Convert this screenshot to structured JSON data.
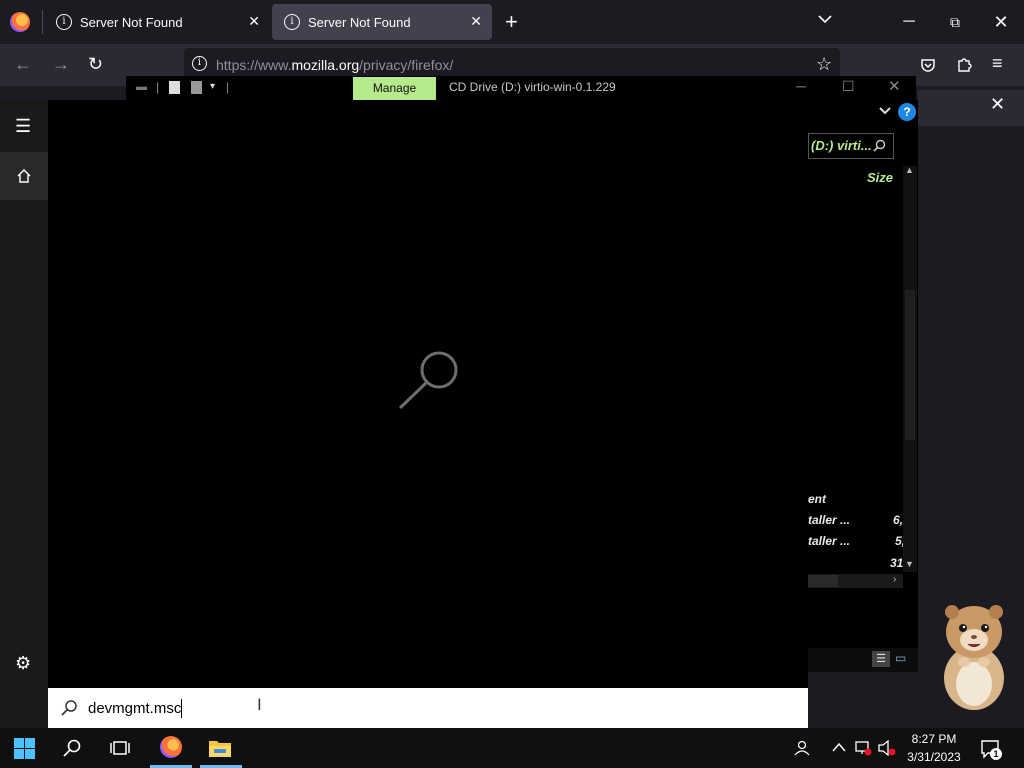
{
  "browser": {
    "tabs": [
      {
        "label": "Server Not Found",
        "active": false
      },
      {
        "label": "Server Not Found",
        "active": true
      }
    ],
    "url": {
      "prefix": "https://www.",
      "domain": "mozilla.org",
      "path": "/privacy/firefox/"
    }
  },
  "explorer": {
    "manage_label": "Manage",
    "title": "CD Drive (D:) virtio-win-0.1.229",
    "search_text": "(D:) virti...",
    "size_header": "Size",
    "rows": [
      {
        "name": "ent",
        "size": ""
      },
      {
        "name": "taller ...",
        "size": "6,"
      },
      {
        "name": "taller ...",
        "size": "5,"
      },
      {
        "name": "",
        "size": "31,"
      }
    ]
  },
  "start_search": {
    "query": "devmgmt.msc"
  },
  "taskbar": {
    "time": "8:27 PM",
    "date": "3/31/2023",
    "notification_count": "1"
  },
  "colors": {
    "accent_green": "#b6eb8c",
    "taskbar_accent": "#76b9ed",
    "help_blue": "#1e88e5"
  }
}
